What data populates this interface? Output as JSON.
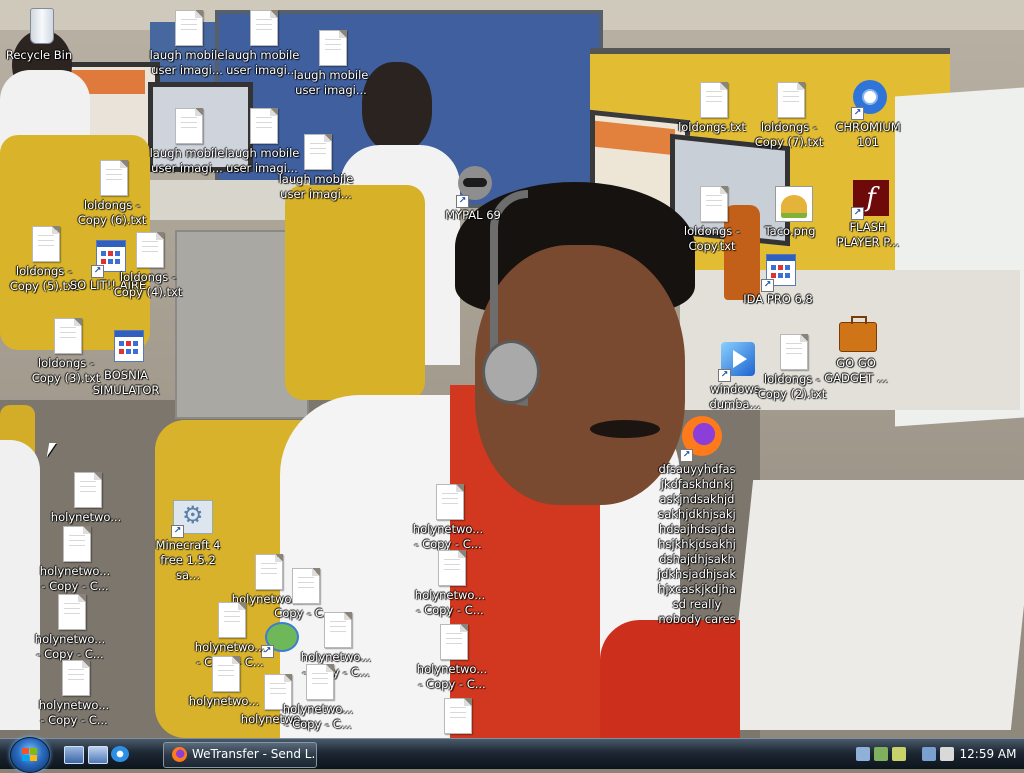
{
  "desktop": {
    "icons": {
      "recycle_bin": "Recycle Bin",
      "laugh1": "laugh mobile\nuser imagi...",
      "laugh2": "laugh mobile\nuser imagi...",
      "laugh3": "laugh mobile\nuser imagi...",
      "laugh4": "laugh mobile\nuser imagi...",
      "laugh5": "laugh mobile\nuser imagi...",
      "laugh6": "laugh mobile\nuser imagi...",
      "loldongs_copy6": "loldongs -\nCopy (6).txt",
      "loldongs_copy5": "loldongs -\nCopy (5).txt",
      "so_lit_aire": "SO LIT!! AIRE",
      "loldongs_copy4": "loldongs -\nCopy (4).txt",
      "loldongs_copy3": "loldongs -\nCopy (3).txt",
      "bosnia": "BOSNIA\nSIMULATOR",
      "mypal": "MYPAL 69",
      "loldongs": "loldongs.txt",
      "loldongs_copy7": "loldongs -\nCopy (7).txt",
      "chromium": "CHROMIUM\n101",
      "loldongs_copy": "loldongs -\nCopy.txt",
      "taco": "Taco.png",
      "flash": "FLASH\nPLAYER P...",
      "ida": "IDA PRO 6.8",
      "windows_dumba": "windows\ndumba...",
      "loldongs_copy2": "loldongs -\nCopy (2).txt",
      "gogo": "GO GO\nGADGET ...",
      "firefox_long": "dfsauyyhdfas\njkdfaskhdnkj\naskjndsakhjd\nsakhjdkhjsakj\nhdsajhdsajda\nhsjkhkjdsakhj\ndshajdhjsakh\njdkhsjadhjsak\nhjxcaskjkdjha\nsd really\nnobody cares",
      "minecraft": "Minecraft 4\nfree 1.5.2 sa...",
      "holy1": "holynetwo...",
      "holy2": "holynetwo...\n- Copy - C...",
      "holy3": "holynetwo...\n- Copy - C...",
      "holy4": "holynetwo...\n- Copy - C...",
      "holy5": "holynetwo...\n- Copy - C...",
      "holy_mid1": "holynetwo...\n- Copy - C...",
      "holy_mid2": "holynetwo...\n- Copy - C...",
      "holy_mid3": "holynetwo...\n- Copy - C...",
      "holy_c1": "holynetwo...",
      "holy_c2": "Copy - C...",
      "holy_c3": "holynetwo...\n- Copy - C...",
      "holy_c4": "holynetwo...\n- Copy - C...",
      "holy_c5": "holynetwo...",
      "holy_c6": "holynetwo...",
      "holy_c7": "holynetwo...\n- Copy - C...",
      "holy_c8": "holynetwo...\n- Copy - C..."
    }
  },
  "taskbar": {
    "task_firefox": "WeTransfer - Send L...",
    "clock": "12:59 AM"
  },
  "colors": {
    "taskbar": "#1d2733",
    "label_text": "#ffffff",
    "start_orb": "#2a6bc0"
  }
}
